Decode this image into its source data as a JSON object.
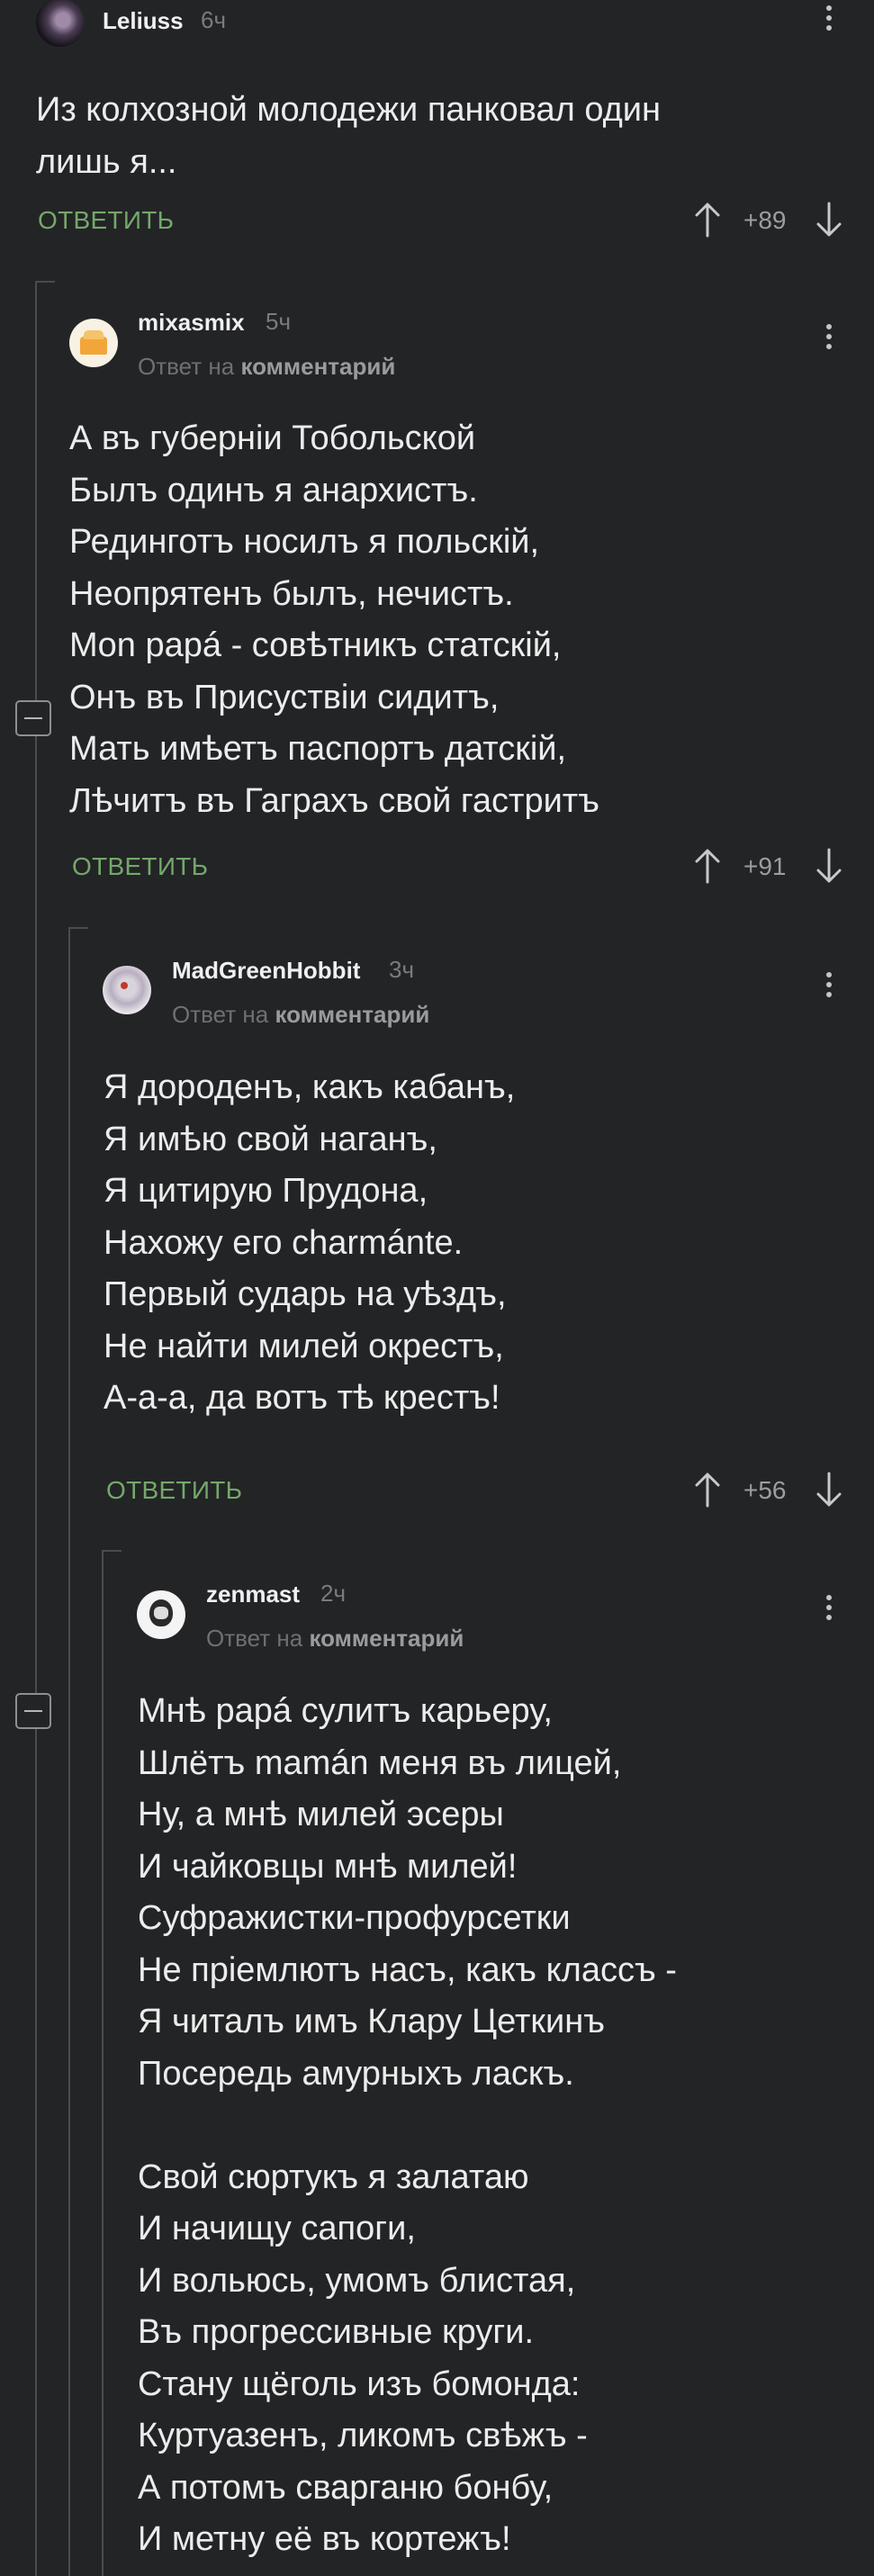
{
  "colors": {
    "background": "#232426",
    "reply": "#74a86a",
    "muted": "#7a7b7d",
    "thread_line": "#4a4b4d"
  },
  "comments": [
    {
      "user": "Leliuss",
      "time": "6ч",
      "text": "Из колхозной молодежи панковал один\nлишь я...",
      "reply_label": "ОТВЕТИТЬ",
      "rating": "+89"
    },
    {
      "user": "mixasmix",
      "time": "5ч",
      "reply_prefix": "Ответ на",
      "reply_target": "комментарий",
      "text": "А въ губерніи Тобольской\nБылъ одинъ я анархистъ.\nРединготъ носилъ я польскій,\nНеопрятенъ былъ, нечистъ.\nMon papá - совѣтникъ статскій,\nОнъ въ Присуствіи сидитъ,\nМать имѣетъ паспортъ датскій,\nЛѣчитъ въ Гаграхъ свой гастритъ",
      "reply_label": "ОТВЕТИТЬ",
      "rating": "+91"
    },
    {
      "user": "MadGreenHobbit",
      "time": "3ч",
      "reply_prefix": "Ответ на",
      "reply_target": "комментарий",
      "text": "Я дороденъ, какъ кабанъ,\nЯ имѣю свой наганъ,\nЯ цитирую Прудона,\nНахожу его charmánte.\nПервый сударь на уѣздъ,\nНе найти милей окрестъ,\nА-а-а, да вотъ тѣ крестъ!",
      "reply_label": "ОТВЕТИТЬ",
      "rating": "+56"
    },
    {
      "user": "zenmast",
      "time": "2ч",
      "reply_prefix": "Ответ на",
      "reply_target": "комментарий",
      "text": "Мнѣ papá сулитъ карьеру,\nШлётъ mamán меня въ лицей,\nНу, а мнѣ милей эсеры\nИ чайковцы мнѣ милей!\nСуфражистки-профурсетки\nНе пріемлютъ насъ, какъ классъ -\nЯ читалъ имъ Клару Цеткинъ\nПосередь амурныхъ ласкъ.\n\nСвой сюртукъ я залатаю\nИ начищу сапоги,\nИ вольюсь, умомъ блистая,\nВъ прогрессивные круги.\nСтану щёголь изъ бомонда:\nКуртуазенъ, ликомъ свѣжъ -\nА потомъ сварганю бонбу,\nИ метну её въ кортежъ!"
    }
  ]
}
